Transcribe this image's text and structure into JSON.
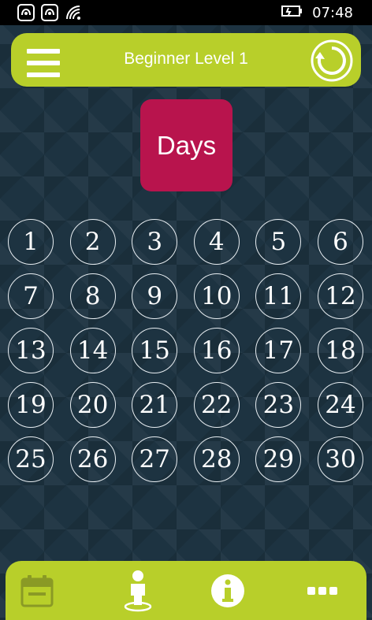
{
  "status_bar": {
    "time": "07:48",
    "icons": [
      "notification-icon",
      "notification-icon",
      "wifi-icon",
      "battery-icon"
    ]
  },
  "header": {
    "title": "Beginner Level 1",
    "menu_icon": "hamburger-menu-icon",
    "reload_icon": "reload-icon"
  },
  "category_card": {
    "label": "Days"
  },
  "days": [
    "1",
    "2",
    "3",
    "4",
    "5",
    "6",
    "7",
    "8",
    "9",
    "10",
    "11",
    "12",
    "13",
    "14",
    "15",
    "16",
    "17",
    "18",
    "19",
    "20",
    "21",
    "22",
    "23",
    "24",
    "25",
    "26",
    "27",
    "28",
    "29",
    "30"
  ],
  "bottom_bar": {
    "items": [
      "calendar-icon",
      "person-icon",
      "info-icon",
      "more-icon"
    ]
  },
  "colors": {
    "accent": "#b8cf2a",
    "card": "#b8144d",
    "background": "#1d3341"
  }
}
